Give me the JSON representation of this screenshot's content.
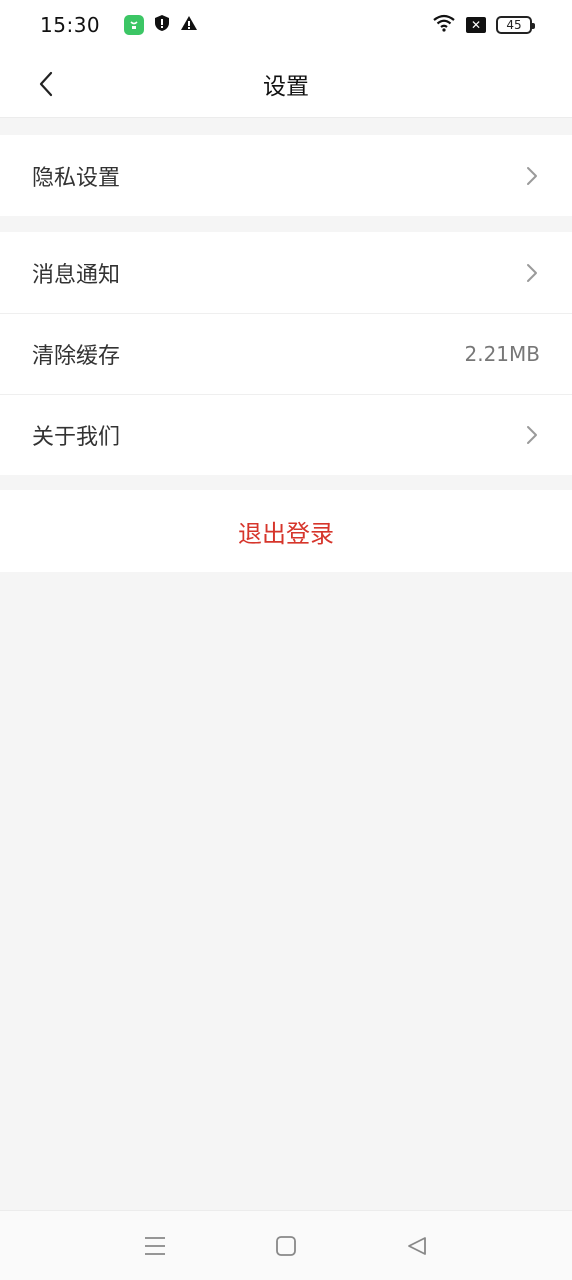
{
  "status_bar": {
    "time": "15:30",
    "battery_level": "45",
    "icons": [
      "app-notification-icon",
      "shield-alert-icon",
      "warning-icon",
      "wifi-icon",
      "sim-no-signal-icon",
      "battery-icon"
    ]
  },
  "header": {
    "title": "设置",
    "back_icon": "chevron-left-icon"
  },
  "sections": {
    "privacy": {
      "label": "隐私设置"
    },
    "notifications": {
      "label": "消息通知"
    },
    "clear_cache": {
      "label": "清除缓存",
      "value": "2.21MB"
    },
    "about": {
      "label": "关于我们"
    }
  },
  "logout": {
    "label": "退出登录",
    "color": "#d6352b"
  },
  "nav_bar": {
    "icons": [
      "menu-icon",
      "home-icon",
      "back-triangle-icon"
    ]
  }
}
